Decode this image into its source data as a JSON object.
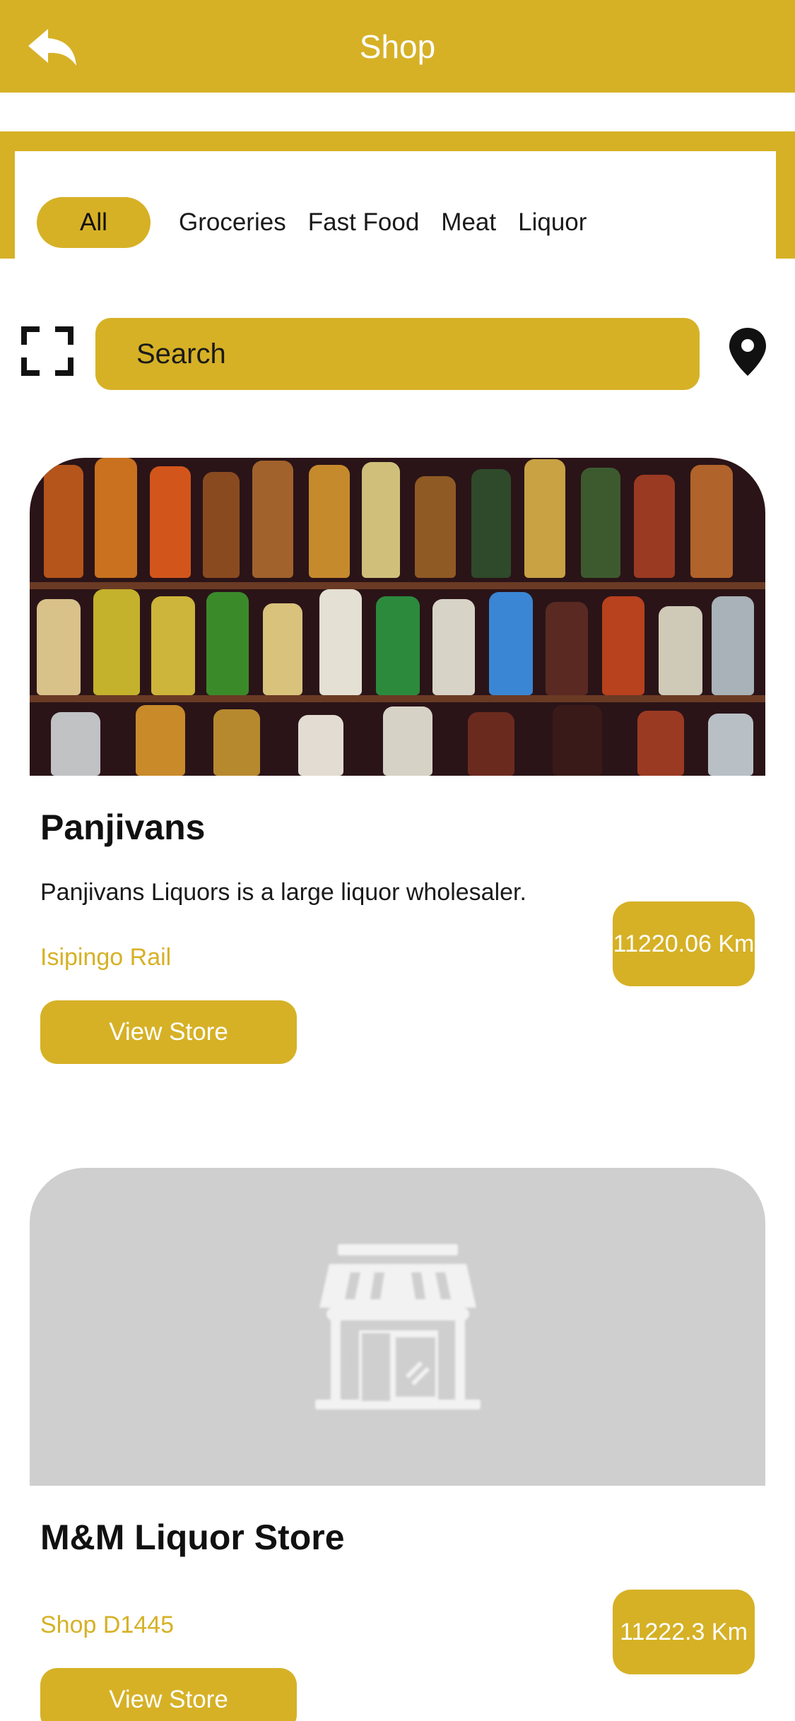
{
  "header": {
    "title": "Shop",
    "back_icon": "back-arrow-icon"
  },
  "categories": {
    "items": [
      {
        "label": "All",
        "active": true
      },
      {
        "label": "Groceries",
        "active": false
      },
      {
        "label": "Fast Food",
        "active": false
      },
      {
        "label": "Meat",
        "active": false
      },
      {
        "label": "Liquor",
        "active": false
      }
    ]
  },
  "search": {
    "placeholder": "Search",
    "scan_icon": "scan-frame-icon",
    "location_icon": "map-pin-icon"
  },
  "stores": [
    {
      "name": "Panjivans",
      "description": "Panjivans Liquors is a large liquor wholesaler.",
      "location": "Isipingo Rail",
      "distance": "11220.06 Km",
      "button_label": "View Store",
      "image": "liquor-shelf-photo"
    },
    {
      "name": "M&M Liquor Store",
      "description": "",
      "location": "Shop D1445",
      "distance": "11222.3 Km",
      "button_label": "View Store",
      "image": "store-placeholder-icon"
    }
  ],
  "colors": {
    "accent": "#D6B126",
    "placeholder_bg": "#cfcfcf",
    "text": "#111111"
  }
}
